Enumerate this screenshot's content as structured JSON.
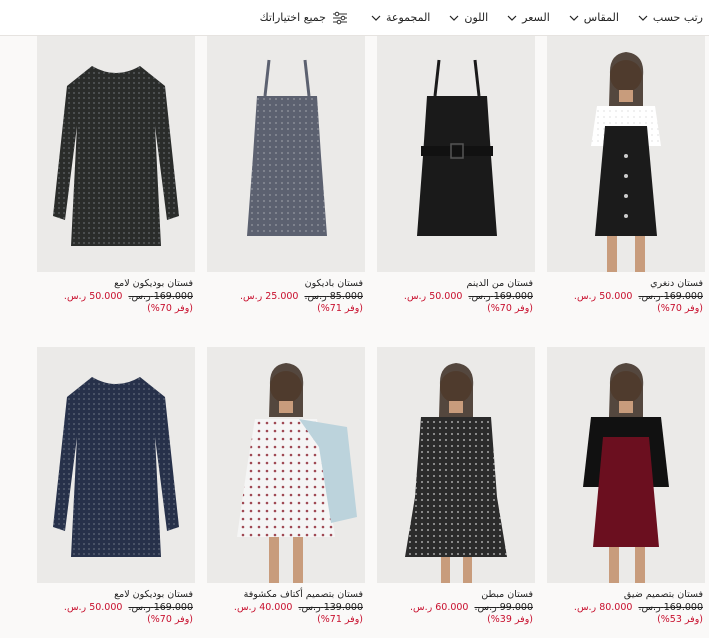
{
  "filters": {
    "sort": "رتب حسب",
    "size": "المقاس",
    "price": "السعر",
    "color": "اللون",
    "collection": "المجموعة",
    "all": "جميع اختياراتك"
  },
  "currency": "ر.س.",
  "accent": "#c8102e",
  "products": [
    {
      "name": "فستان دنغري",
      "orig": "169.000",
      "sale": "50.000",
      "save": "(وفر 70%)",
      "fabric": "#1b1b1b",
      "style": "dungaree"
    },
    {
      "name": "فستان من الدينم",
      "orig": "169.000",
      "sale": "50.000",
      "save": "(وفر 70%)",
      "fabric": "#1a1a1a",
      "style": "strap-belt"
    },
    {
      "name": "فستان باديكون",
      "orig": "85.000",
      "sale": "25.000",
      "save": "(وفر 71%)",
      "fabric": "#5c6170",
      "style": "strap"
    },
    {
      "name": "فستان بوديكون لامع",
      "orig": "169.000",
      "sale": "50.000",
      "save": "(وفر 70%)",
      "fabric": "#2a2c2a",
      "style": "long-sleeve"
    },
    {
      "name": "فستان بتصميم ضيق",
      "orig": "169.000",
      "sale": "80.000",
      "save": "(وفر 53%)",
      "fabric": "#6b0f1f",
      "style": "model-red"
    },
    {
      "name": "فستان مبطن",
      "orig": "99.000",
      "sale": "60.000",
      "save": "(وفر 39%)",
      "fabric": "#2b2b2b",
      "style": "model-print"
    },
    {
      "name": "فستان بتصميم أكتاف مكشوفة",
      "orig": "139.000",
      "sale": "40.000",
      "save": "(وفر 71%)",
      "fabric": "#f2f2f2",
      "style": "model-white"
    },
    {
      "name": "فستان بوديكون لامع",
      "orig": "169.000",
      "sale": "50.000",
      "save": "(وفر 70%)",
      "fabric": "#27314a",
      "style": "long-sleeve-navy"
    }
  ]
}
